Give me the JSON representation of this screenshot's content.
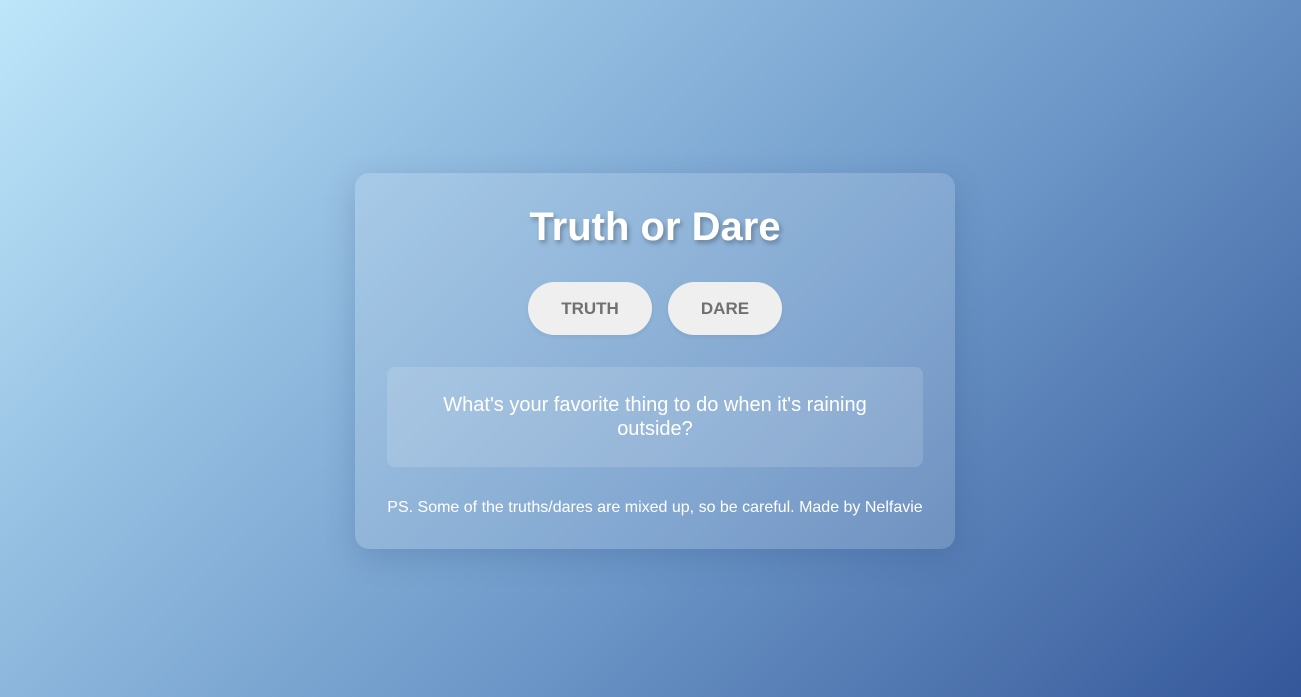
{
  "app": {
    "title": "Truth or Dare"
  },
  "buttons": {
    "truth_label": "TRUTH",
    "dare_label": "DARE"
  },
  "question": {
    "text": "What's your favorite thing to do when it's raining outside?"
  },
  "footer": {
    "text": "PS. Some of the truths/dares are mixed up, so be careful. Made by Nelfavie"
  },
  "colors": {
    "background_start": "#bde6fa",
    "background_end": "#33579a",
    "button_bg": "#f0eff0",
    "button_text": "#707070",
    "text": "#ffffff"
  }
}
